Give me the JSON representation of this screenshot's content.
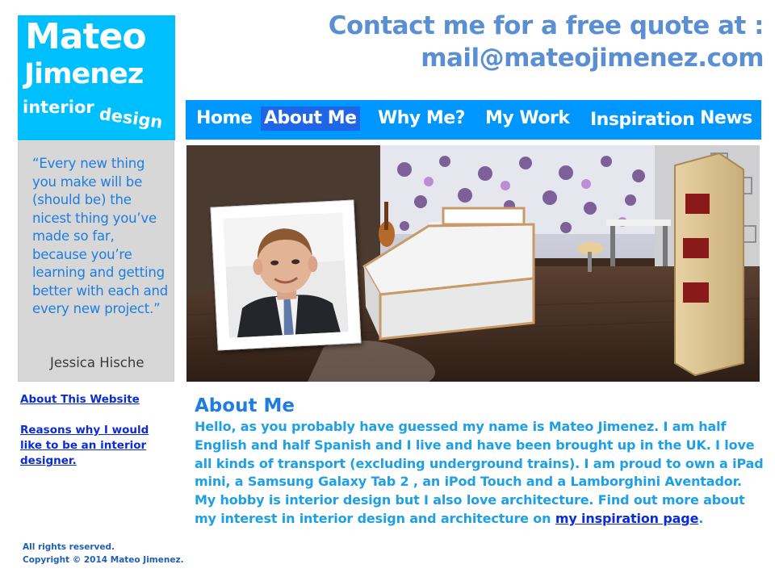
{
  "logo": {
    "line1": "Mateo",
    "line2": "Jimenez",
    "line3": "interior",
    "line4": "design"
  },
  "contact": {
    "line1": "Contact me for a free quote at :",
    "line2": "mail@mateojimenez.com"
  },
  "nav": {
    "items": [
      {
        "label": "Home"
      },
      {
        "label": "About Me"
      },
      {
        "label": "Why Me?"
      },
      {
        "label": "My Work"
      },
      {
        "label": "Inspiration"
      },
      {
        "label": "News"
      }
    ],
    "active": "About Me"
  },
  "quote": {
    "text": "“Every new thing you make will be (should be) the nicest thing you’ve made so far, because you’re learning and getting better with each and every new project.”",
    "author": "Jessica Hische"
  },
  "sidebar": {
    "links": [
      {
        "label": "About This Website"
      },
      {
        "label": "Reasons why I would like to be an interior designer."
      }
    ]
  },
  "main": {
    "title": "About Me",
    "para1": "Hello, as you probably have guessed my name is Mateo Jimenez. I am half English and half  Spanish and I live and have been brought up in the UK. I love all kinds of transport (excluding underground trains). I am proud to own a iPad mini, a Samsung Galaxy Tab 2 , an iPod Touch and a Lamborghini Aventador.",
    "para2_prefix": "My hobby is interior design but I also love architecture. Find out more about my interest in interior design and architecture on ",
    "para2_link": "my inspiration page",
    "para2_suffix": "."
  },
  "footer": {
    "line1": "All rights reserved.",
    "line2": "Copyright © 2014 Mateo Jimenez."
  },
  "colors": {
    "logo_bg": "#00bfff",
    "nav_bg": "#0096ff",
    "nav_active_bg": "#1e66e6",
    "contact_text": "#5b8fd3",
    "quote_bg": "#d7d7d7",
    "link": "#0b2bd6"
  }
}
